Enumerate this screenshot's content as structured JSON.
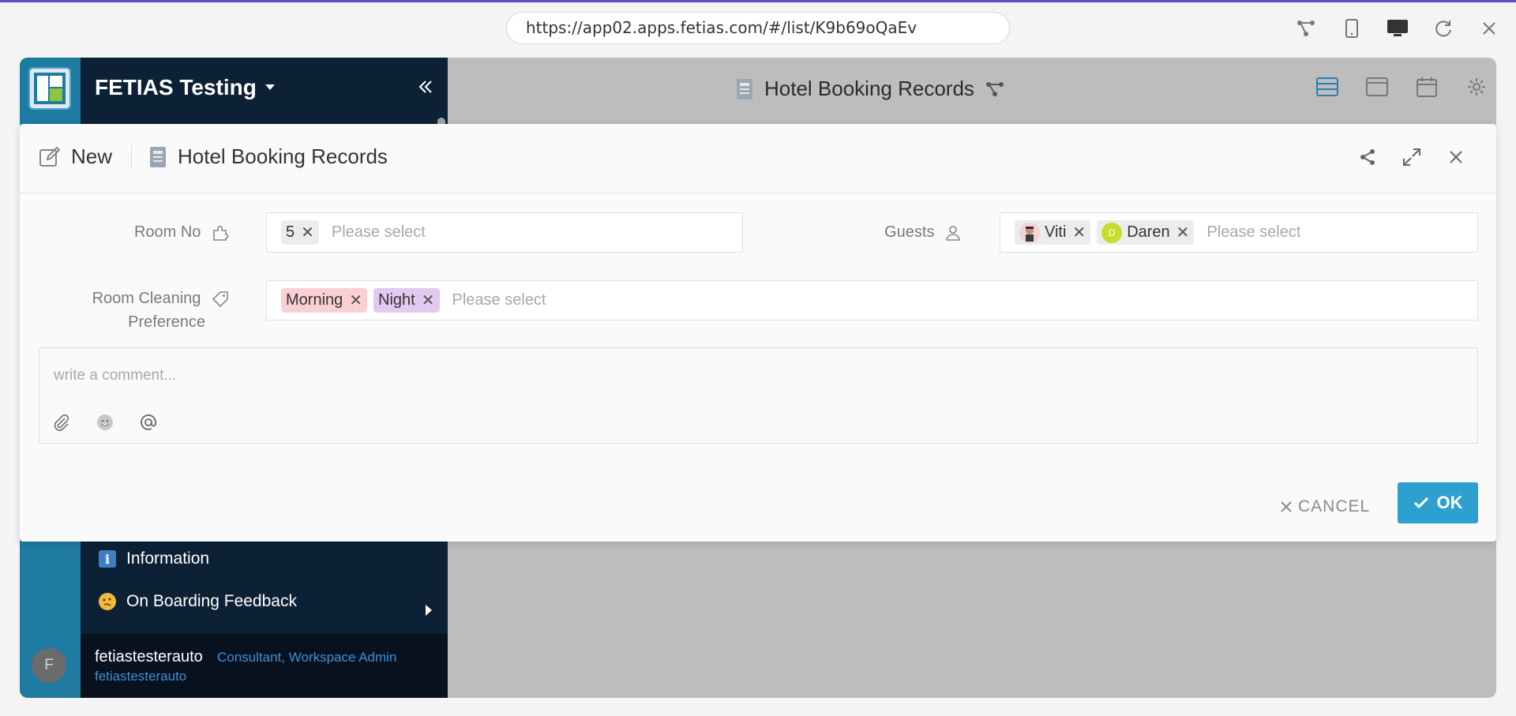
{
  "browser": {
    "url": "https://app02.apps.fetias.com/#/list/K9b69oQaEv",
    "icons": [
      "share-tree-icon",
      "mobile-icon",
      "desktop-icon",
      "refresh-icon",
      "close-icon"
    ]
  },
  "sidebar": {
    "workspace": "FETIAS Testing",
    "items": [
      {
        "label": "Information",
        "icon": "info-icon"
      },
      {
        "label": "On Boarding Feedback",
        "icon": "thinking-face-icon"
      }
    ],
    "user": {
      "initial": "F",
      "name": "fetiastesterauto",
      "roles": "Consultant, Workspace Admin",
      "handle": "fetiastesterauto"
    }
  },
  "main": {
    "title": "Hotel Booking Records"
  },
  "modal": {
    "mode": "New",
    "title": "Hotel Booking Records",
    "fields": {
      "room_no": {
        "label": "Room No",
        "chips": [
          "5"
        ],
        "placeholder": "Please select"
      },
      "guests": {
        "label": "Guests",
        "chips": [
          {
            "name": "Viti",
            "avatar": ""
          },
          {
            "name": "Daren",
            "avatar": "D"
          }
        ],
        "placeholder": "Please select"
      },
      "cleaning": {
        "label_line1": "Room Cleaning",
        "label_line2": "Preference",
        "chips": [
          {
            "label": "Morning",
            "color": "#fbd0d4"
          },
          {
            "label": "Night",
            "color": "#e2c9f0"
          }
        ],
        "placeholder": "Please select"
      }
    },
    "comment": {
      "placeholder": "write a comment..."
    },
    "buttons": {
      "cancel": "CANCEL",
      "ok": "OK"
    }
  },
  "colors": {
    "accent": "#2ea0cf",
    "sidebar_bg": "#0d2136",
    "rail_bg": "#1f7ba1"
  }
}
